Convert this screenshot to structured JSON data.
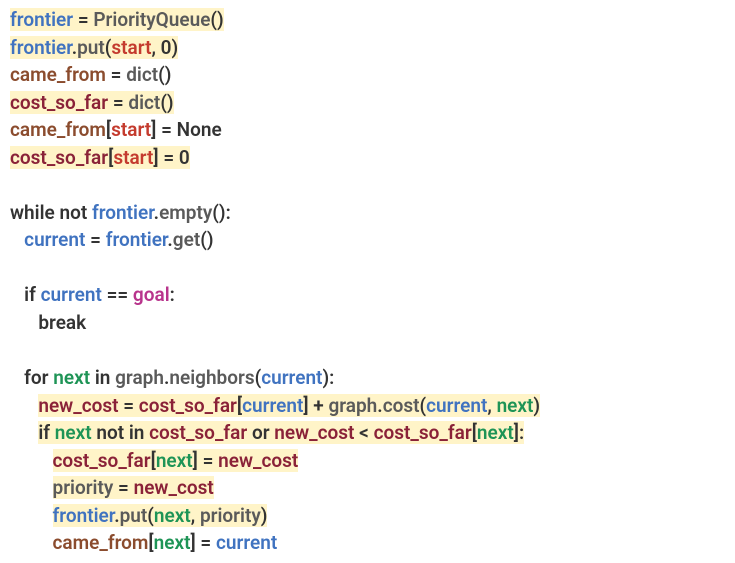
{
  "tokens": {
    "frontier": "frontier",
    "priorityqueue": "PriorityQueue",
    "put": "put",
    "start": "start",
    "came_from": "came_from",
    "cost_so_far": "cost_so_far",
    "dict": "dict",
    "none": "None",
    "zero": "0",
    "while": "while",
    "not": "not",
    "empty": "empty",
    "current": "current",
    "get": "get",
    "if": "if",
    "eqeq": "==",
    "goal": "goal",
    "break": "break",
    "for": "for",
    "next": "next",
    "in": "in",
    "graph": "graph",
    "neighbors": "neighbors",
    "new_cost": "new_cost",
    "plus": "+",
    "cost": "cost",
    "not_in": "not in",
    "or": "or",
    "lt": "<",
    "priority": "priority",
    "eq": "=",
    "comma": ",",
    "lparen": "(",
    "rparen": ")",
    "lbrack": "[",
    "rbrack": "]",
    "dot": ".",
    "colon": ":"
  }
}
